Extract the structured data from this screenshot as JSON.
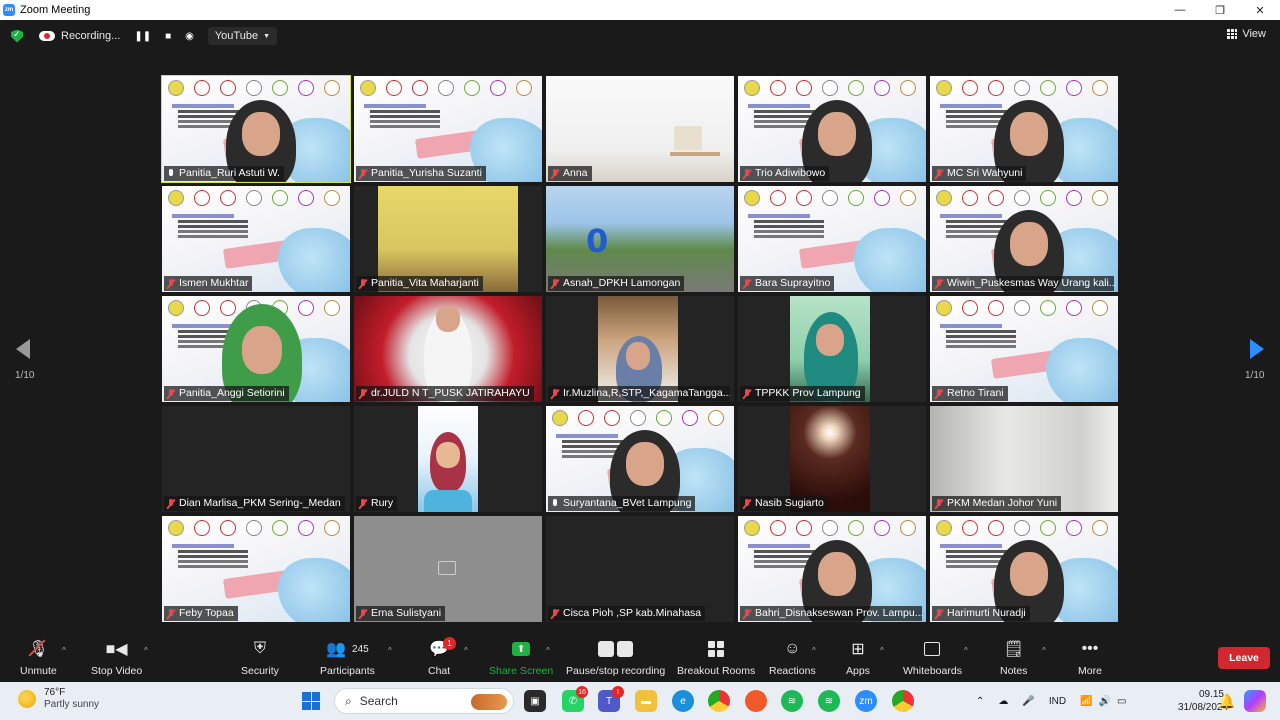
{
  "window": {
    "title": "Zoom Meeting"
  },
  "topbar": {
    "recording_label": "Recording...",
    "livestream_label": "YouTube",
    "view_label": "View"
  },
  "pagination": {
    "left": "1/10",
    "right": "1/10"
  },
  "participants": [
    {
      "name": "Panitia_Ruri Astuti W.",
      "muted": false,
      "scene": "slide-person",
      "active": true
    },
    {
      "name": "Panitia_Yurisha Suzanti",
      "muted": true,
      "scene": "slide"
    },
    {
      "name": "Anna",
      "muted": true,
      "scene": "room-white"
    },
    {
      "name": "Trio Adiwibowo",
      "muted": true,
      "scene": "slide-person"
    },
    {
      "name": "MC Sri Wahyuni",
      "muted": true,
      "scene": "slide-person"
    },
    {
      "name": "Ismen Mukhtar",
      "muted": true,
      "scene": "slide"
    },
    {
      "name": "Panitia_Vita Maharjanti",
      "muted": true,
      "scene": "room-yellow"
    },
    {
      "name": "Asnah_DPKH Lamongan",
      "muted": true,
      "scene": "park"
    },
    {
      "name": "Bara Suprayitno",
      "muted": true,
      "scene": "slide"
    },
    {
      "name": "Wiwin_Puskesmas Way Urang kali...",
      "muted": true,
      "scene": "slide-person"
    },
    {
      "name": "Panitia_Anggi Setiorini",
      "muted": true,
      "scene": "slide-person-green"
    },
    {
      "name": "dr.JULD N T_PUSK JATIRAHAYU",
      "muted": true,
      "scene": "event"
    },
    {
      "name": "Ir.Muzlina,R,STP,_KagamaTangga...",
      "muted": true,
      "scene": "office-room"
    },
    {
      "name": "TPPKK Prov Lampung",
      "muted": true,
      "scene": "green-room"
    },
    {
      "name": "Retno Tirani",
      "muted": true,
      "scene": "slide"
    },
    {
      "name": "Dian Marlisa_PKM Sering-_Medan",
      "muted": true,
      "scene": "blank"
    },
    {
      "name": "Rury",
      "muted": true,
      "scene": "avatar"
    },
    {
      "name": "Suryantana_BVet Lampung",
      "muted": false,
      "scene": "slide-person"
    },
    {
      "name": "Nasib Sugiarto",
      "muted": true,
      "scene": "dark-light"
    },
    {
      "name": "PKM Medan Johor Yuni",
      "muted": true,
      "scene": "white-room"
    },
    {
      "name": "Feby Topaa",
      "muted": true,
      "scene": "slide"
    },
    {
      "name": "Erna Sulistyani",
      "muted": true,
      "scene": "gray"
    },
    {
      "name": "Cisca Pioh ,SP kab.Minahasa",
      "muted": true,
      "scene": "blank"
    },
    {
      "name": "Bahri_Disnakseswan Prov. Lampu...",
      "muted": true,
      "scene": "slide-person"
    },
    {
      "name": "Harimurti Nuradji",
      "muted": true,
      "scene": "slide-person"
    }
  ],
  "toolbar": {
    "unmute": "Unmute",
    "stop_video": "Stop Video",
    "security": "Security",
    "participants": "Participants",
    "participants_count": "245",
    "chat": "Chat",
    "chat_badge": "1",
    "share_screen": "Share Screen",
    "pause_stop_recording": "Pause/stop recording",
    "breakout_rooms": "Breakout Rooms",
    "reactions": "Reactions",
    "apps": "Apps",
    "whiteboards": "Whiteboards",
    "notes": "Notes",
    "more": "More",
    "leave": "Leave"
  },
  "taskbar": {
    "temperature": "76°F",
    "weather": "Partly sunny",
    "search_placeholder": "Search",
    "whatsapp_badge": "16",
    "language": "IND",
    "time": "09.15",
    "date": "31/08/2024"
  },
  "colors": {
    "accent": "#2d8cff",
    "active_speaker": "#d6e24a",
    "leave": "#d1272f",
    "share": "#1fb141",
    "muted": "#e5484d"
  }
}
